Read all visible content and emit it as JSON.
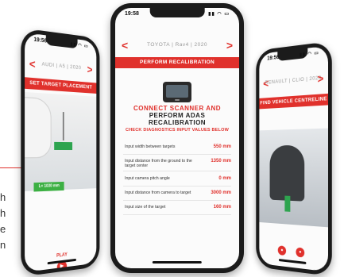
{
  "edge_text": [
    "h",
    "h",
    "e",
    "n"
  ],
  "left_phone": {
    "time": "19:56",
    "status_icons": "▮▮ ◠ ▭",
    "nav_title": "AUDI | A5 | 2020",
    "header": "SET TARGET PLACEMENT",
    "green_badge": "L= 1030 mm",
    "play_label": "PLAY",
    "play_icon": "▶"
  },
  "center_phone": {
    "time": "19:58",
    "status_icons": "▮▮ ◠ ▭",
    "nav_prev": "<",
    "nav_next": ">",
    "nav_title": "TOYOTA | Rav4 | 2020",
    "header": "PERFORM RECALIBRATION",
    "heading_red": "CONNECT SCANNER AND",
    "heading_dark_1": "PERFORM ADAS",
    "heading_dark_2": "RECALIBRATION",
    "subheading": "CHECK DIAGNOSTICS INPUT VALUES BELOW",
    "inputs": [
      {
        "label": "Input width between targets",
        "value": "550 mm"
      },
      {
        "label": "Input distance from the ground to the target center",
        "value": "1350 mm"
      },
      {
        "label": "Input camera pitch angle",
        "value": "0 mm"
      },
      {
        "label": "Input distance from camera to target",
        "value": "3000 mm"
      },
      {
        "label": "Input size of the target",
        "value": "160 mm"
      }
    ]
  },
  "right_phone": {
    "time": "19:56",
    "status_icons": "▮▮ ◠ ▭",
    "nav_title": "RENAULT | CLIO | 2020",
    "header": "FIND VEHICLE CENTRELINE",
    "btn_left": "●",
    "btn_right": "●"
  },
  "colors": {
    "accent": "#e0312c",
    "green": "#3cb043"
  }
}
